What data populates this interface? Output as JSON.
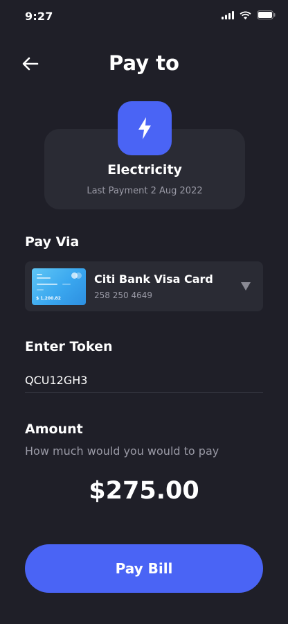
{
  "status_bar": {
    "time": "9:27",
    "icons": [
      "signal-icon",
      "wifi-icon",
      "battery-icon"
    ]
  },
  "header": {
    "back_icon": "arrow-left-icon",
    "title": "Pay to"
  },
  "biller": {
    "icon": "lightning-icon",
    "name": "Electricity",
    "last_payment": "Last Payment 2 Aug 2022"
  },
  "pay_via": {
    "label": "Pay Via",
    "card": {
      "name": "Citi Bank Visa Card",
      "number": "258 250 4649",
      "thumb_amount": "$ 1,200.82",
      "dropdown_icon": "triangle-down-icon"
    }
  },
  "token": {
    "label": "Enter Token",
    "value": "QCU12GH3"
  },
  "amount": {
    "label": "Amount",
    "subtitle": "How much would you would to pay",
    "value": "$275.00"
  },
  "actions": {
    "pay_label": "Pay Bill"
  },
  "colors": {
    "background": "#1f1f28",
    "surface": "#2a2b34",
    "accent": "#4a64f5",
    "muted_text": "#9a9aa6"
  }
}
